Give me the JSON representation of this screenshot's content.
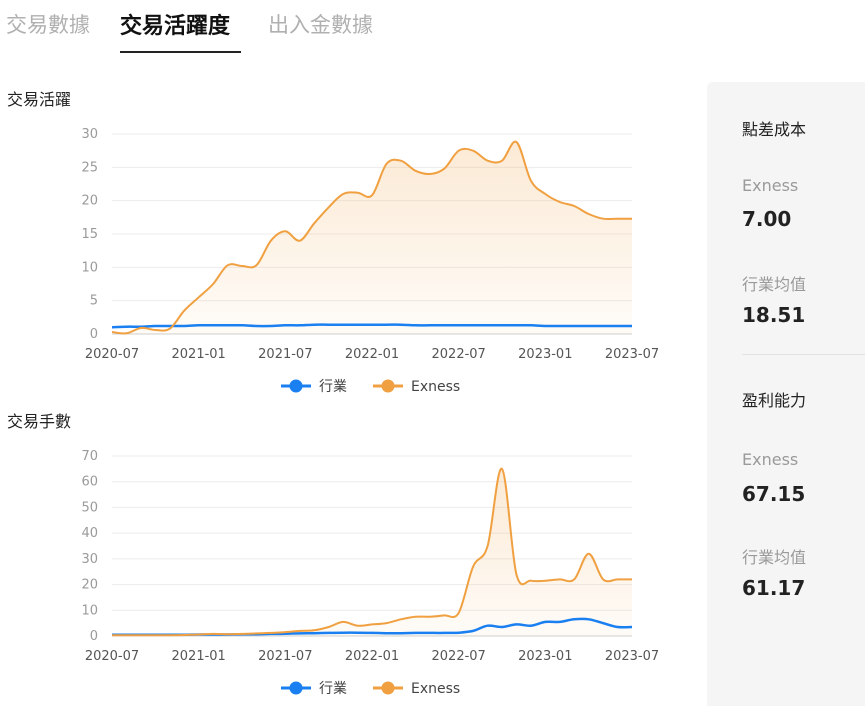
{
  "tabs": [
    {
      "label": "交易數據"
    },
    {
      "label": "交易活躍度"
    },
    {
      "label": "出入金數據"
    }
  ],
  "active_tab": 1,
  "chart_data": [
    {
      "type": "area",
      "title": "交易活躍",
      "x": [
        "2020-07",
        "2020-08",
        "2020-09",
        "2020-10",
        "2020-11",
        "2020-12",
        "2021-01",
        "2021-02",
        "2021-03",
        "2021-04",
        "2021-05",
        "2021-06",
        "2021-07",
        "2021-08",
        "2021-09",
        "2021-10",
        "2021-11",
        "2021-12",
        "2022-01",
        "2022-02",
        "2022-03",
        "2022-04",
        "2022-05",
        "2022-06",
        "2022-07",
        "2022-08",
        "2022-09",
        "2022-10",
        "2022-11",
        "2022-12",
        "2023-01",
        "2023-02",
        "2023-03",
        "2023-04",
        "2023-05",
        "2023-06",
        "2023-07"
      ],
      "xticks": [
        "2020-07",
        "2021-01",
        "2021-07",
        "2022-01",
        "2022-07",
        "2023-01",
        "2023-07"
      ],
      "ylim": [
        0,
        30
      ],
      "yticks": [
        0,
        5,
        10,
        15,
        20,
        25,
        30
      ],
      "series": [
        {
          "name": "行業",
          "color": "#1a7ff0",
          "fill": false,
          "values": [
            1.0,
            1.1,
            1.1,
            1.2,
            1.2,
            1.2,
            1.3,
            1.3,
            1.3,
            1.3,
            1.2,
            1.2,
            1.3,
            1.3,
            1.4,
            1.4,
            1.4,
            1.4,
            1.4,
            1.4,
            1.4,
            1.3,
            1.3,
            1.3,
            1.3,
            1.3,
            1.3,
            1.3,
            1.3,
            1.3,
            1.2,
            1.2,
            1.2,
            1.2,
            1.2,
            1.2,
            1.2
          ]
        },
        {
          "name": "Exness",
          "color": "#f0a040",
          "fill": true,
          "values": [
            0.3,
            0.1,
            0.9,
            0.6,
            0.8,
            3.5,
            5.5,
            7.5,
            10.3,
            10.2,
            10.3,
            14.0,
            15.4,
            14.0,
            16.6,
            19.0,
            21.0,
            21.2,
            20.8,
            25.5,
            26.0,
            24.5,
            24.0,
            24.8,
            27.5,
            27.5,
            26.0,
            26.0,
            28.8,
            23.0,
            21.0,
            19.8,
            19.2,
            18.0,
            17.3,
            17.3,
            17.3
          ]
        }
      ],
      "legend_position": "bottom-center"
    },
    {
      "type": "area",
      "title": "交易手數",
      "x": [
        "2020-07",
        "2020-08",
        "2020-09",
        "2020-10",
        "2020-11",
        "2020-12",
        "2021-01",
        "2021-02",
        "2021-03",
        "2021-04",
        "2021-05",
        "2021-06",
        "2021-07",
        "2021-08",
        "2021-09",
        "2021-10",
        "2021-11",
        "2021-12",
        "2022-01",
        "2022-02",
        "2022-03",
        "2022-04",
        "2022-05",
        "2022-06",
        "2022-07",
        "2022-08",
        "2022-09",
        "2022-10",
        "2022-11",
        "2022-12",
        "2023-01",
        "2023-02",
        "2023-03",
        "2023-04",
        "2023-05",
        "2023-06",
        "2023-07"
      ],
      "xticks": [
        "2020-07",
        "2021-01",
        "2021-07",
        "2022-01",
        "2022-07",
        "2023-01",
        "2023-07"
      ],
      "ylim": [
        0,
        70
      ],
      "yticks": [
        0,
        10,
        20,
        30,
        40,
        50,
        60,
        70
      ],
      "series": [
        {
          "name": "行業",
          "color": "#1a7ff0",
          "fill": false,
          "values": [
            0.5,
            0.5,
            0.5,
            0.5,
            0.5,
            0.5,
            0.6,
            0.6,
            0.6,
            0.7,
            0.7,
            0.8,
            0.9,
            1.0,
            1.1,
            1.2,
            1.3,
            1.3,
            1.2,
            1.1,
            1.1,
            1.2,
            1.2,
            1.2,
            1.3,
            2.0,
            4.0,
            3.5,
            4.5,
            4.0,
            5.5,
            5.5,
            6.5,
            6.5,
            5.0,
            3.5,
            3.5
          ]
        },
        {
          "name": "Exness",
          "color": "#f0a040",
          "fill": true,
          "values": [
            0.3,
            0.3,
            0.3,
            0.3,
            0.3,
            0.4,
            0.6,
            0.8,
            0.7,
            0.8,
            1.0,
            1.2,
            1.5,
            2.0,
            2.2,
            3.5,
            5.5,
            4.0,
            4.5,
            5.0,
            6.5,
            7.5,
            7.5,
            8.0,
            9.0,
            27.0,
            35.0,
            65.0,
            24.0,
            21.5,
            21.5,
            22.0,
            22.0,
            32.0,
            22.0,
            22.0,
            22.0
          ]
        }
      ],
      "legend_position": "bottom-center"
    }
  ],
  "side_panel": {
    "spread_title": "點差成本",
    "spread_exness_label": "Exness",
    "spread_exness_value": "7.00",
    "spread_industry_label": "行業均值",
    "spread_industry_value": "18.51",
    "profit_title": "盈利能力",
    "profit_exness_label": "Exness",
    "profit_exness_value": "67.15",
    "profit_industry_label": "行業均值",
    "profit_industry_value": "61.17"
  }
}
